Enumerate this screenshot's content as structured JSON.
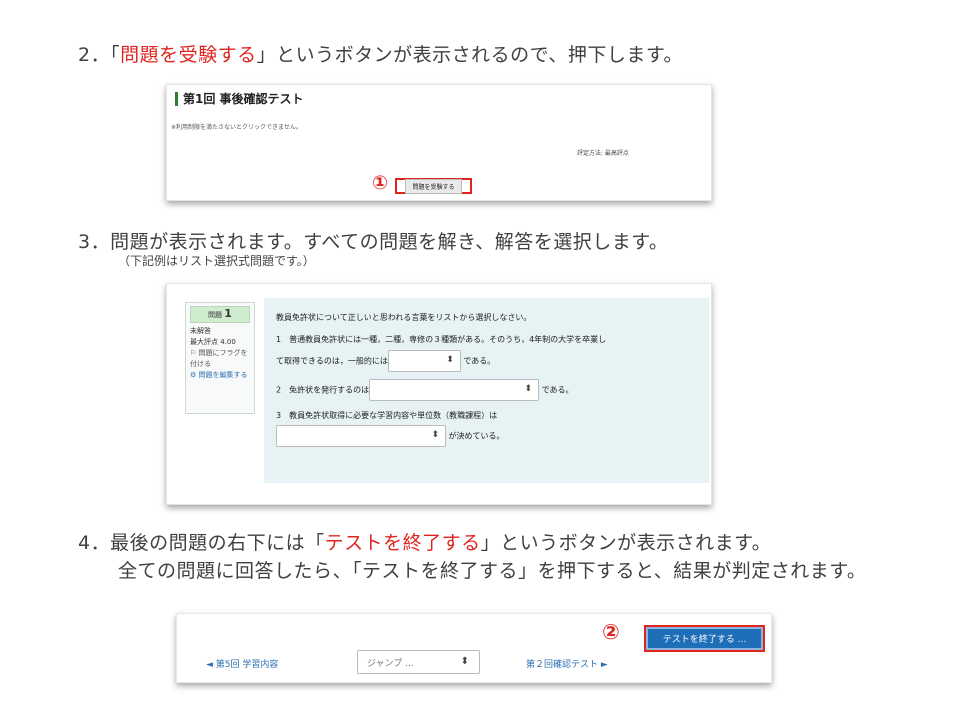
{
  "step2": {
    "prefix": "2．「",
    "highlight": "問題を受験する",
    "suffix": "」というボタンが表示されるので、押下します。"
  },
  "screen1": {
    "title": "第1回 事後確認テスト",
    "note": "※利用制限を満たさないとクリックできません。",
    "grading": "評定方法: 最高評点",
    "marker": "①",
    "button_label": "問題を受験する"
  },
  "step3": {
    "text": "3．問題が表示されます。すべての問題を解き、解答を選択します。",
    "sub": "（下記例はリスト選択式問題です。）"
  },
  "screen2": {
    "question_label": "問題",
    "question_number": "1",
    "status": "未解答",
    "max_score": "最大評点 4.00",
    "flag_label": "問題にフラグを付ける",
    "edit_label": "問題を編集する",
    "prompt": "教員免許状について正しいと思われる言葉をリストから選択しなさい。",
    "line1a": "1　普通教員免許状には一種，二種，専修の３種類がある。そのうち，4年制の大学を卒業し",
    "line1b": "て取得できるのは，一般的には",
    "line1c": "である。",
    "line2a": "2　免許状を発行するのは",
    "line2b": "である。",
    "line3a": "3　教員免許状取得に必要な学習内容や単位数（教職課程）は",
    "line3b": "が決めている。"
  },
  "step4": {
    "line1_prefix": "4．最後の問題の右下には「",
    "line1_highlight": "テストを終了する",
    "line1_suffix": "」というボタンが表示されます。",
    "line2": "全ての問題に回答したら、「テストを終了する」を押下すると、結果が判定されます。"
  },
  "screen3": {
    "marker": "②",
    "finish_label": "テストを終了する ...",
    "prev_link": "◄ 第5回 学習内容",
    "jump_placeholder": "ジャンプ ...",
    "next_link": "第２回確認テスト ►"
  },
  "colors": {
    "highlight": "#e0251f",
    "button_blue": "#1f6fb8",
    "question_bg": "#e6f2f3"
  }
}
